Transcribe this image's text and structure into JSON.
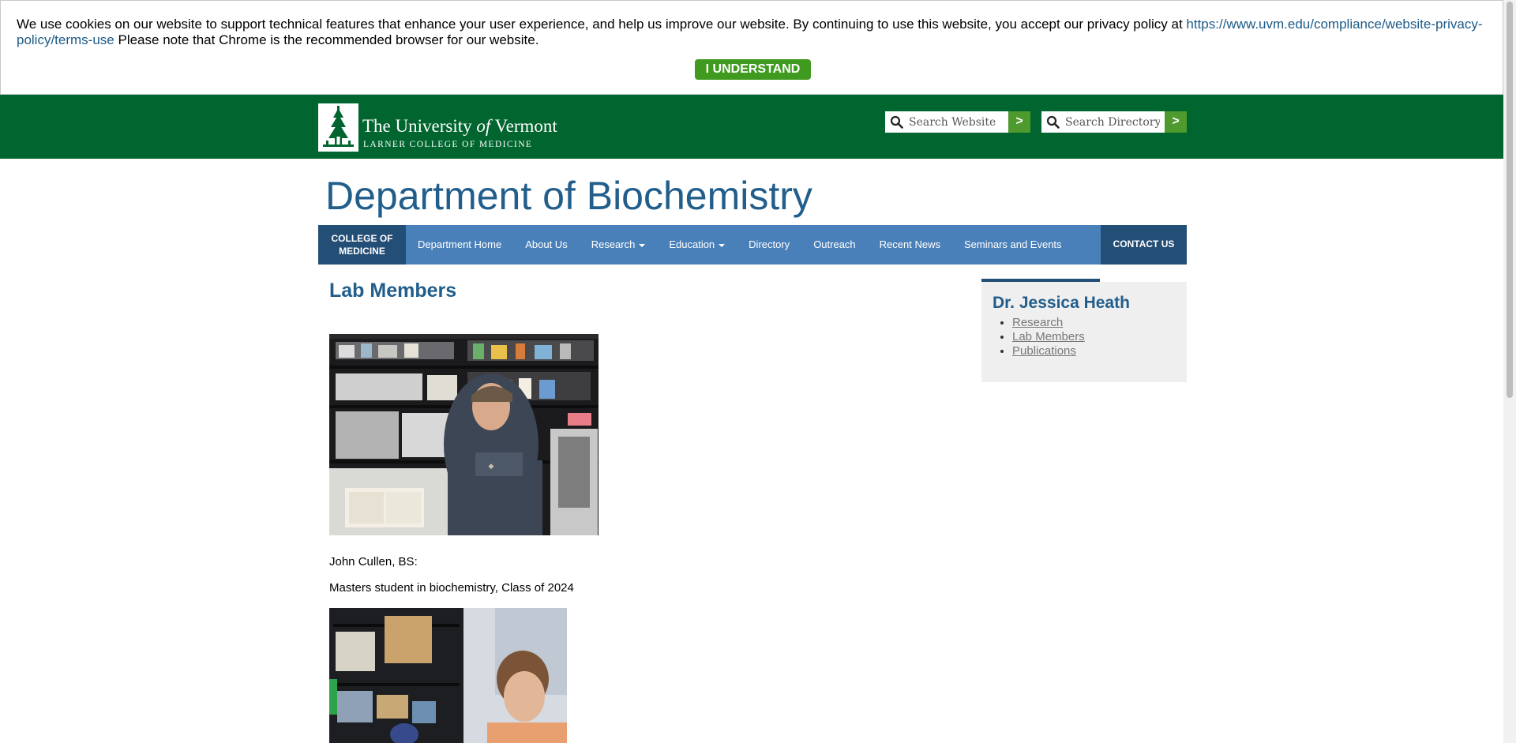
{
  "cookie_banner": {
    "message": "We use cookies on our website to support technical features that enhance your user experience, and help us improve our website. By continuing to use this website, you accept our privacy policy at ",
    "link_text": "https://www.uvm.edu/compliance/website-privacy-policy/terms-use",
    "note": " Please note that Chrome is the recommended browser for our website.",
    "button_label": "I UNDERSTAND"
  },
  "header": {
    "logo_line1_pre": "The University ",
    "logo_line1_of": "of",
    "logo_line1_post": " Vermont",
    "logo_line2": "LARNER COLLEGE OF MEDICINE",
    "search_website": {
      "placeholder": "Search Website",
      "go_label": ">"
    },
    "search_directory": {
      "placeholder": "Search Directory",
      "go_label": ">"
    },
    "icons": [
      "search-icon",
      "uvm-tree-logo"
    ]
  },
  "department_title": "Department of Biochemistry",
  "nav": {
    "college_line1": "COLLEGE OF",
    "college_line2": "MEDICINE",
    "items": [
      {
        "label": "Department Home",
        "dropdown": false
      },
      {
        "label": "About Us",
        "dropdown": false
      },
      {
        "label": "Research",
        "dropdown": true
      },
      {
        "label": "Education",
        "dropdown": true
      },
      {
        "label": "Directory",
        "dropdown": false
      },
      {
        "label": "Outreach",
        "dropdown": false
      },
      {
        "label": "Recent News",
        "dropdown": false
      },
      {
        "label": "Seminars and Events",
        "dropdown": false
      }
    ],
    "contact_label": "CONTACT US"
  },
  "main": {
    "heading": "Lab Members",
    "members": [
      {
        "name": "John Cullen, BS:",
        "role": "Masters student in biochemistry, Class of 2024"
      }
    ]
  },
  "sidebar": {
    "title": "Dr. Jessica Heath",
    "links": [
      "Research",
      "Lab Members",
      "Publications"
    ]
  },
  "colors": {
    "header_green": "#00652e",
    "button_green": "#3f9a1f",
    "nav_blue": "#4a80b9",
    "nav_dark": "#234e76",
    "title_blue": "#215e8b"
  }
}
